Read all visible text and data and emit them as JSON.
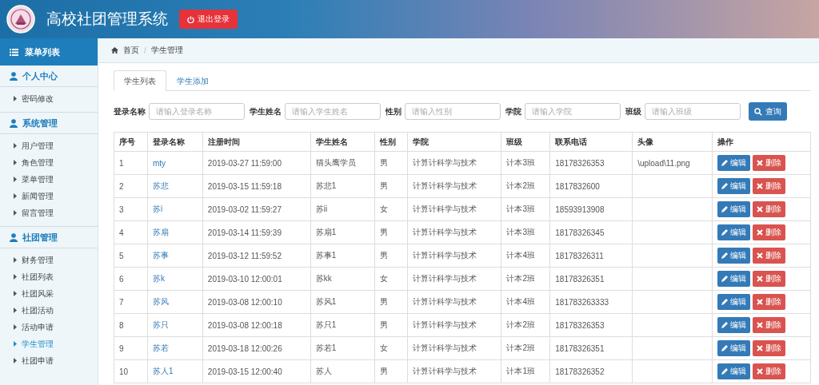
{
  "header": {
    "title": "高校社团管理系统",
    "logout": "退出登录"
  },
  "sidebar": {
    "title": "菜单列表",
    "groups": [
      {
        "label": "个人中心",
        "children": [
          {
            "label": "密码修改",
            "selected": false
          }
        ]
      },
      {
        "label": "系统管理",
        "children": [
          {
            "label": "用户管理",
            "selected": false
          },
          {
            "label": "角色管理",
            "selected": false
          },
          {
            "label": "菜单管理",
            "selected": false
          },
          {
            "label": "新闻管理",
            "selected": false
          },
          {
            "label": "留言管理",
            "selected": false
          }
        ]
      },
      {
        "label": "社团管理",
        "children": [
          {
            "label": "财务管理",
            "selected": false
          },
          {
            "label": "社团列表",
            "selected": false
          },
          {
            "label": "社团风采",
            "selected": false
          },
          {
            "label": "社团活动",
            "selected": false
          },
          {
            "label": "活动申请",
            "selected": false
          },
          {
            "label": "学生管理",
            "selected": true
          },
          {
            "label": "社团申请",
            "selected": false
          }
        ]
      }
    ]
  },
  "breadcrumb": [
    "首页",
    "学生管理"
  ],
  "breadcrumb_separator": "/",
  "tabs": [
    {
      "label": "学生列表",
      "selected": true
    },
    {
      "label": "学生添加",
      "selected": false
    }
  ],
  "filters": [
    {
      "label": "登录名称",
      "placeholder": "请输入登录名称"
    },
    {
      "label": "学生姓名",
      "placeholder": "请输入学生姓名"
    },
    {
      "label": "性别",
      "placeholder": "请输入性别"
    },
    {
      "label": "学院",
      "placeholder": "请输入学院"
    },
    {
      "label": "班级",
      "placeholder": "请输入班级"
    }
  ],
  "search_button": "查询",
  "table": {
    "columns": [
      "序号",
      "登录名称",
      "注册时间",
      "学生姓名",
      "性别",
      "学院",
      "班级",
      "联系电话",
      "头像",
      "操作"
    ],
    "rows": [
      {
        "index": "1",
        "login": "mty",
        "time": "2019-03-27 11:59:00",
        "name": "猫头鹰学员",
        "gender": "男",
        "college": "计算计科学与技术",
        "class": "计本3班",
        "phone": "18178326353",
        "avatar": "\\upload\\11.png",
        "edit": "编辑",
        "delete": "删除"
      },
      {
        "index": "2",
        "login": "苏悲",
        "time": "2019-03-15 11:59:18",
        "name": "苏悲1",
        "gender": "男",
        "college": "计算计科学与技术",
        "class": "计本2班",
        "phone": "1817832600",
        "edit": "编辑",
        "delete": "删除"
      },
      {
        "index": "3",
        "login": "苏i",
        "time": "2019-03-02 11:59:27",
        "name": "苏ii",
        "gender": "女",
        "college": "计算计科学与技术",
        "class": "计本3班",
        "phone": "18593913908",
        "edit": "编辑",
        "delete": "删除"
      },
      {
        "index": "4",
        "login": "苏扇",
        "time": "2019-03-14 11:59:39",
        "name": "苏扇1",
        "gender": "男",
        "college": "计算计科学与技术",
        "class": "计本3班",
        "phone": "18178326345",
        "edit": "编辑",
        "delete": "删除"
      },
      {
        "index": "5",
        "login": "苏事",
        "time": "2019-03-12 11:59:52",
        "name": "苏事1",
        "gender": "男",
        "college": "计算计科学与技术",
        "class": "计本4班",
        "phone": "18178326311",
        "edit": "编辑",
        "delete": "删除"
      },
      {
        "index": "6",
        "login": "苏k",
        "time": "2019-03-10 12:00:01",
        "name": "苏kk",
        "gender": "女",
        "college": "计算计科学与技术",
        "class": "计本2班",
        "phone": "18178326351",
        "edit": "编辑",
        "delete": "删除"
      },
      {
        "index": "7",
        "login": "苏风",
        "time": "2019-03-08 12:00:10",
        "name": "苏风1",
        "gender": "男",
        "college": "计算计科学与技术",
        "class": "计本4班",
        "phone": "181783263333",
        "edit": "编辑",
        "delete": "删除"
      },
      {
        "index": "8",
        "login": "苏只",
        "time": "2019-03-08 12:00:18",
        "name": "苏只1",
        "gender": "男",
        "college": "计算计科学与技术",
        "class": "计本2班",
        "phone": "18178326353",
        "edit": "编辑",
        "delete": "删除"
      },
      {
        "index": "9",
        "login": "苏若",
        "time": "2019-03-18 12:00:26",
        "name": "苏若1",
        "gender": "女",
        "college": "计算计科学与技术",
        "class": "计本2班",
        "phone": "18178326351",
        "edit": "编辑",
        "delete": "删除"
      },
      {
        "index": "10",
        "login": "苏人1",
        "time": "2019-03-15 12:00:40",
        "name": "苏人",
        "gender": "男",
        "college": "计算计科学与技术",
        "class": "计本1班",
        "phone": "18178326352",
        "edit": "编辑",
        "delete": "删除"
      }
    ]
  }
}
